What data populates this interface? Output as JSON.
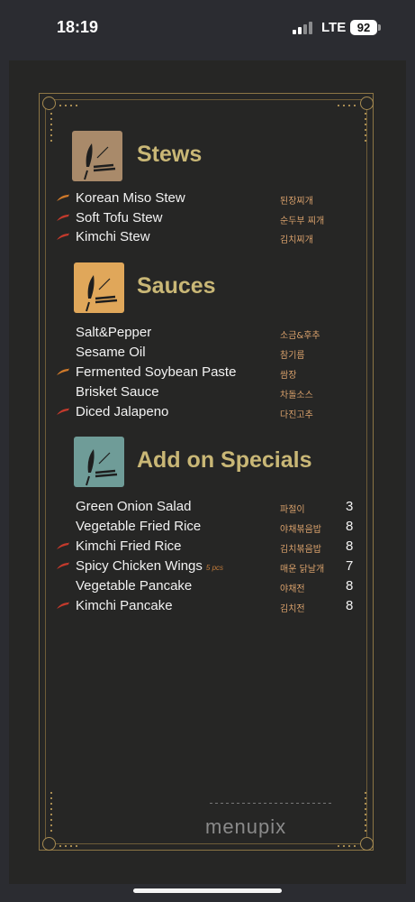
{
  "status": {
    "time": "18:19",
    "network": "LTE",
    "battery": "92"
  },
  "sections": {
    "stews": {
      "title": "Stews",
      "items": [
        {
          "name": "Korean Miso Stew",
          "ko": "된장찌개"
        },
        {
          "name": "Soft Tofu Stew",
          "ko": "순두부 찌개"
        },
        {
          "name": "Kimchi Stew",
          "ko": "김치찌개"
        }
      ]
    },
    "sauces": {
      "title": "Sauces",
      "items": [
        {
          "name": "Salt&Pepper",
          "ko": "소금&후추"
        },
        {
          "name": "Sesame Oil",
          "ko": "참기름"
        },
        {
          "name": "Fermented Soybean Paste",
          "ko": "쌈장"
        },
        {
          "name": "Brisket Sauce",
          "ko": "차돌소스"
        },
        {
          "name": "Diced Jalapeno",
          "ko": "다진고추"
        }
      ]
    },
    "specials": {
      "title": "Add on Specials",
      "items": [
        {
          "name": "Green Onion Salad",
          "ko": "파절이",
          "price": "3"
        },
        {
          "name": "Vegetable Fried Rice",
          "ko": "야채볶음밥",
          "price": "8"
        },
        {
          "name": "Kimchi Fried Rice",
          "ko": "김치볶음밥",
          "price": "8"
        },
        {
          "name": "Spicy Chicken Wings",
          "note": "5 pcs",
          "ko": "매운 닭날개",
          "price": "7"
        },
        {
          "name": "Vegetable Pancake",
          "ko": "야채전",
          "price": "8"
        },
        {
          "name": "Kimchi Pancake",
          "ko": "김치전",
          "price": "8"
        }
      ]
    }
  },
  "icon_colors": {
    "stews": "#a98a6a",
    "sauces": "#e0a75a",
    "specials": "#6f9c98"
  },
  "pepper_colors": {
    "red": "#c33a2c",
    "orange": "#d07a2a"
  },
  "watermark": "menupix"
}
